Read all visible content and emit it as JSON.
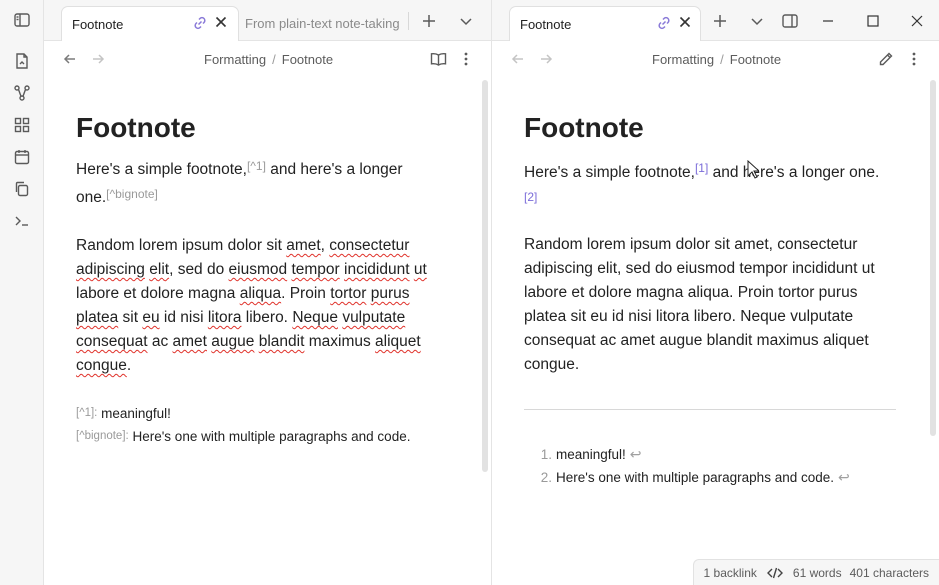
{
  "left_tabs": [
    {
      "title": "Footnote",
      "active": true
    },
    {
      "title": "From plain-text note-taking",
      "active": false
    }
  ],
  "right_tabs": [
    {
      "title": "Footnote",
      "active": true
    }
  ],
  "breadcrumb": {
    "folder": "Formatting",
    "separator": "/",
    "note": "Footnote"
  },
  "editor": {
    "title": "Footnote",
    "line1_before": "Here's a simple footnote,",
    "line1_ref1": "[^1]",
    "line1_after": " and here's a longer",
    "line2_word": "one.",
    "line2_ref2": "[^bignote]",
    "lorem": [
      {
        "t": "Random lorem ipsum dolor sit ",
        "s": false
      },
      {
        "t": "amet",
        "s": true
      },
      {
        "t": ", ",
        "s": false
      },
      {
        "t": "consectetur",
        "s": true
      },
      {
        "t": " ",
        "s": false
      },
      {
        "t": "adipiscing",
        "s": true
      },
      {
        "t": " ",
        "s": false
      },
      {
        "t": "elit",
        "s": true
      },
      {
        "t": ", sed do ",
        "s": false
      },
      {
        "t": "eiusmod",
        "s": true
      },
      {
        "t": " ",
        "s": false
      },
      {
        "t": "tempor",
        "s": true
      },
      {
        "t": " ",
        "s": false
      },
      {
        "t": "incididunt",
        "s": true
      },
      {
        "t": " ",
        "s": false
      },
      {
        "t": "ut",
        "s": true
      },
      {
        "t": " labore et dolore magna ",
        "s": false
      },
      {
        "t": "aliqua",
        "s": true
      },
      {
        "t": ". Proin ",
        "s": false
      },
      {
        "t": "tortor",
        "s": true
      },
      {
        "t": " ",
        "s": false
      },
      {
        "t": "purus",
        "s": true
      },
      {
        "t": " ",
        "s": false
      },
      {
        "t": "platea",
        "s": true
      },
      {
        "t": " sit ",
        "s": false
      },
      {
        "t": "eu",
        "s": true
      },
      {
        "t": " id nisi ",
        "s": false
      },
      {
        "t": "litora",
        "s": true
      },
      {
        "t": " libero. ",
        "s": false
      },
      {
        "t": "Neque",
        "s": true
      },
      {
        "t": " ",
        "s": false
      },
      {
        "t": "vulputate",
        "s": true
      },
      {
        "t": " ",
        "s": false
      },
      {
        "t": "consequat",
        "s": true
      },
      {
        "t": " ac ",
        "s": false
      },
      {
        "t": "amet",
        "s": true
      },
      {
        "t": " ",
        "s": false
      },
      {
        "t": "augue",
        "s": true
      },
      {
        "t": " ",
        "s": false
      },
      {
        "t": "blandit",
        "s": true
      },
      {
        "t": " maximus ",
        "s": false
      },
      {
        "t": "aliquet",
        "s": true
      },
      {
        "t": " ",
        "s": false
      },
      {
        "t": "congue",
        "s": true
      },
      {
        "t": ".",
        "s": false
      }
    ],
    "def1_label": "[^1]:",
    "def1_text": " meaningful!",
    "def2_label": "[^bignote]:",
    "def2_text": " Here's one with multiple paragraphs and code."
  },
  "reading": {
    "title": "Footnote",
    "line1_before": "Here's a simple footnote,",
    "ref1": "[1]",
    "line1_after": " and here's a longer one.",
    "ref2": "[2]",
    "lorem": "Random lorem ipsum dolor sit amet, consectetur adipiscing elit, sed do eiusmod tempor incididunt ut labore et dolore magna aliqua. Proin tortor purus platea sit eu id nisi litora libero. Neque vulputate consequat ac amet augue blandit maximus aliquet congue.",
    "footnotes": [
      {
        "num": "1.",
        "text": "meaningful!"
      },
      {
        "num": "2.",
        "text": "Here's one with multiple paragraphs and code."
      }
    ],
    "backref_glyph": "↩"
  },
  "status": {
    "backlinks": "1 backlink",
    "words": "61 words",
    "characters": "401 characters"
  },
  "colors": {
    "accent": "#7b6cd9",
    "spellcheck": "#e0322b"
  }
}
